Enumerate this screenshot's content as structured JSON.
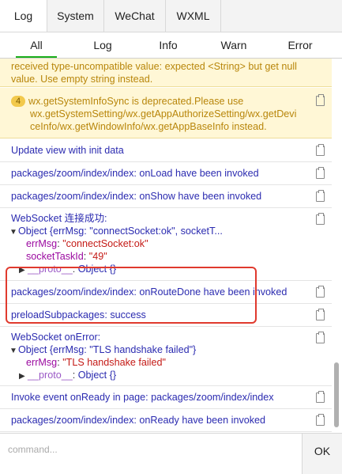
{
  "tabs": [
    "Log",
    "System",
    "WeChat",
    "WXML"
  ],
  "levels": [
    "All",
    "Log",
    "Info",
    "Warn",
    "Error"
  ],
  "warn1": {
    "line1": "received type-uncompatible value: expected <String> but get null",
    "line2": "value. Use empty string instead."
  },
  "warn2": {
    "badge": "4",
    "line1": "wx.getSystemInfoSync is deprecated.Please use",
    "line2": "wx.getSystemSetting/wx.getAppAuthorizeSetting/wx.getDevi",
    "line3": "ceInfo/wx.getWindowInfo/wx.getAppBaseInfo instead."
  },
  "logs": {
    "update_view": "Update view with init data",
    "onload": "packages/zoom/index/index: onLoad have been invoked",
    "onshow": "packages/zoom/index/index: onShow have been invoked",
    "onroutedone": "packages/zoom/index/index: onRouteDone have been invoked",
    "preload": "preloadSubpackages: success",
    "invoke_ready": "Invoke event onReady in page: packages/zoom/index/index",
    "onready": "packages/zoom/index/index: onReady have been invoked"
  },
  "ws_success": {
    "title": "WebSocket 连接成功:",
    "object_summary": "Object {errMsg: \"connectSocket:ok\", socketT...",
    "errmsg_key": "errMsg",
    "errmsg_val": "\"connectSocket:ok\"",
    "taskid_key": "socketTaskId",
    "taskid_val": "\"49\"",
    "proto_key": "__proto__",
    "proto_val": "Object {}"
  },
  "ws_error": {
    "title": "WebSocket onError:",
    "object_summary": "Object {errMsg: \"TLS handshake failed\"}",
    "errmsg_key": "errMsg",
    "errmsg_val": "\"TLS handshake failed\"",
    "proto_key": "__proto__",
    "proto_val": "Object {}"
  },
  "command": {
    "placeholder": "command...",
    "ok_label": "OK"
  },
  "colors": {
    "highlight": "#e03a2e",
    "active_tab_underline": "#1aad19",
    "warn_bg": "#fff7d6"
  },
  "icons": {
    "copy": "clipboard-icon",
    "expand": "triangle-down-icon",
    "collapse": "triangle-right-icon"
  }
}
